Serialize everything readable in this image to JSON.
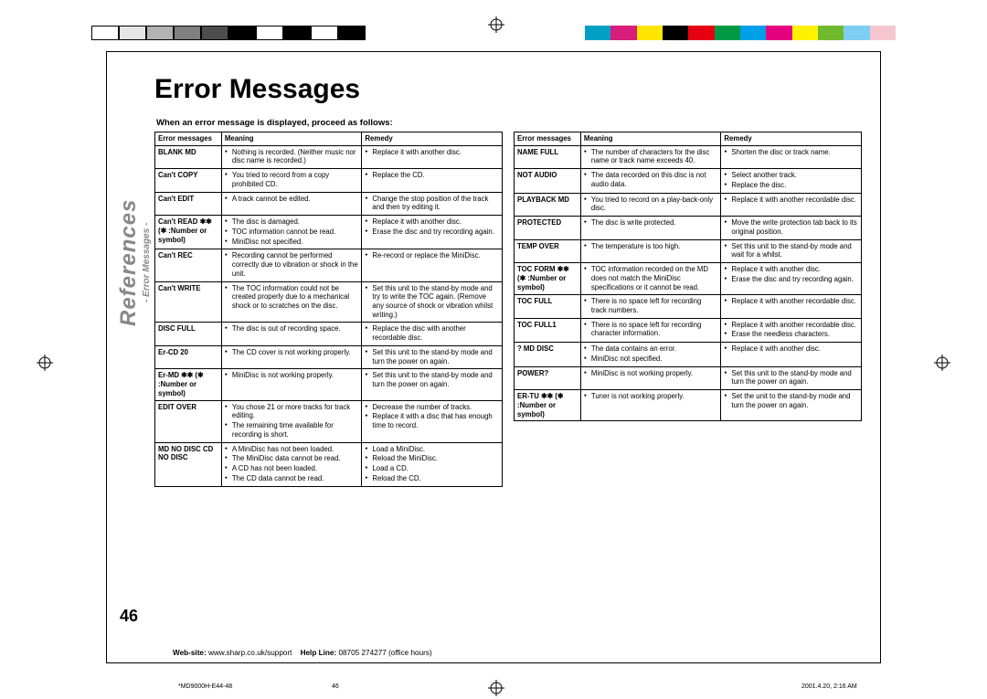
{
  "title": "Error Messages",
  "intro": "When an error message is displayed, proceed as follows:",
  "sidebar": {
    "main": "References",
    "sub": "- Error Messages -"
  },
  "pageNumber": "46",
  "headers": {
    "c1": "Error messages",
    "c2": "Meaning",
    "c3": "Remedy"
  },
  "left": [
    {
      "e": "BLANK MD",
      "m": [
        "Nothing is recorded. (Neither music nor disc name is recorded.)"
      ],
      "r": [
        "Replace it with another disc."
      ]
    },
    {
      "e": "Can't COPY",
      "m": [
        "You tried to record from a copy prohibited CD."
      ],
      "r": [
        "Replace the CD."
      ]
    },
    {
      "e": "Can't EDIT",
      "m": [
        "A track cannot be edited."
      ],
      "r": [
        "Change the stop position of the track and then try editing it."
      ]
    },
    {
      "e": "Can't READ ✱✱ (✱ :Number or symbol)",
      "m": [
        "The disc is damaged.",
        "TOC information cannot be read.",
        "MiniDisc not specified."
      ],
      "r": [
        "Replace it with another disc.",
        "Erase the disc and try recording again."
      ]
    },
    {
      "e": "Can't REC",
      "m": [
        "Recording cannot be performed correctly due to vibration or shock in the unit."
      ],
      "r": [
        "Re-record or replace the MiniDisc."
      ]
    },
    {
      "e": "Can't WRITE",
      "m": [
        "The TOC information could not be created properly due to a mechanical shock or to scratches on the disc."
      ],
      "r": [
        "Set this unit to the stand-by mode and try to write the TOC again. (Remove any source of shock or vibration whilst writing.)"
      ]
    },
    {
      "e": "DISC FULL",
      "m": [
        "The disc is out of recording space."
      ],
      "r": [
        "Replace the disc with another recordable disc."
      ]
    },
    {
      "e": "Er-CD 20",
      "m": [
        "The CD cover is not working properly."
      ],
      "r": [
        "Set this unit to the stand-by mode and turn the power on again."
      ]
    },
    {
      "e": "Er-MD ✱✱ (✱ :Number or symbol)",
      "m": [
        "MiniDisc is not working properly."
      ],
      "r": [
        "Set this unit to the stand-by mode and turn the power on again."
      ]
    },
    {
      "e": "EDIT OVER",
      "m": [
        "You chose 21 or more tracks for track editing.",
        "The remaining time available for recording is short."
      ],
      "r": [
        "Decrease the number of tracks.",
        "Replace it with a disc that has enough time to record."
      ]
    },
    {
      "e": "MD NO DISC CD NO DISC",
      "m": [
        "A MiniDisc has not been loaded.",
        "The MiniDisc data cannot be read.",
        "A CD has not been loaded.",
        "The CD data cannot be read."
      ],
      "r": [
        "Load a MiniDisc.",
        "Reload the MiniDisc.",
        "Load a CD.",
        "Reload the CD."
      ]
    }
  ],
  "right": [
    {
      "e": "NAME FULL",
      "m": [
        "The number of characters for the disc name or track name exceeds 40."
      ],
      "r": [
        "Shorten the disc or track name."
      ]
    },
    {
      "e": "NOT AUDIO",
      "m": [
        "The data recorded on this disc is not audio data."
      ],
      "r": [
        "Select another track.",
        "Replace the disc."
      ]
    },
    {
      "e": "PLAYBACK MD",
      "m": [
        "You tried to record on a play-back-only disc."
      ],
      "r": [
        "Replace it with another recordable disc."
      ]
    },
    {
      "e": "PROTECTED",
      "m": [
        "The disc is write protected."
      ],
      "r": [
        "Move the write protection tab back to its original position."
      ]
    },
    {
      "e": "TEMP OVER",
      "m": [
        "The temperature is too high."
      ],
      "r": [
        "Set this unit to the stand-by mode and wait for a whilst."
      ]
    },
    {
      "e": "TOC FORM ✱✱ (✱ :Number or symbol)",
      "m": [
        "TOC information recorded on the MD does not match the MiniDisc specifications or it cannot be read."
      ],
      "r": [
        "Replace it with another disc.",
        "Erase the disc and try recording again."
      ]
    },
    {
      "e": "TOC FULL",
      "m": [
        "There is no space left for recording track numbers."
      ],
      "r": [
        "Replace it with another recordable disc."
      ]
    },
    {
      "e": "TOC FULL1",
      "m": [
        "There is no space left for recording character information."
      ],
      "r": [
        "Replace it with another recordable disc.",
        "Erase the needless characters."
      ]
    },
    {
      "e": "? MD DISC",
      "m": [
        "The data contains an error.",
        "MiniDisc not specified."
      ],
      "r": [
        "Replace it with another disc."
      ]
    },
    {
      "e": "POWER?",
      "m": [
        "MiniDisc is not working properly."
      ],
      "r": [
        "Set this unit to the stand-by mode and turn the power on again."
      ]
    },
    {
      "e": "ER-TU ✱✱ (✱ :Number or symbol)",
      "m": [
        "Tuner is not working properly."
      ],
      "r": [
        "Set the unit to the stand-by mode and turn the power on again."
      ]
    }
  ],
  "footer": {
    "webLabel": "Web-site:",
    "web": "www.sharp.co.uk/support",
    "helpLabel": "Help Line:",
    "help": "08705 274277 (office hours)"
  },
  "slug": {
    "file": "*MD9000H-E44-48",
    "page": "46",
    "date": "2001.4.20, 2:16 AM"
  },
  "colors_left": [
    "#fff",
    "#e6e6e6",
    "#b3b3b3",
    "#808080",
    "#4d4d4d",
    "#000",
    "#fff",
    "#000",
    "#fff",
    "#000"
  ],
  "colors_right": [
    "#00a0c6",
    "#d81e7c",
    "#ffe600",
    "#000",
    "#e60012",
    "#009944",
    "#00a0e9",
    "#e4007f",
    "#fff100",
    "#6fba2c",
    "#7ecef4",
    "#f6c6d0"
  ]
}
